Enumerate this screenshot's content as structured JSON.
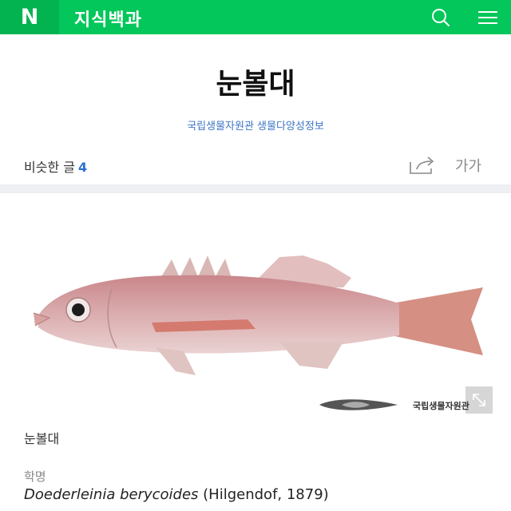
{
  "header": {
    "logo": "N",
    "title": "지식백과",
    "icons": [
      "search-icon",
      "menu-icon"
    ],
    "brand_color": "#03c75a"
  },
  "article": {
    "title": "눈볼대",
    "source": "국립생물자원관 생물다양성정보",
    "similar_label": "비슷한 글",
    "similar_count": "4",
    "font_size_button": "가가",
    "image_caption": "눈볼대",
    "watermark_text": "국립생물자원관",
    "scientific_name_label": "학명",
    "scientific_name_genus_species": "Doederleinia berycoides",
    "scientific_name_authority": " (Hilgendof, 1879)"
  }
}
